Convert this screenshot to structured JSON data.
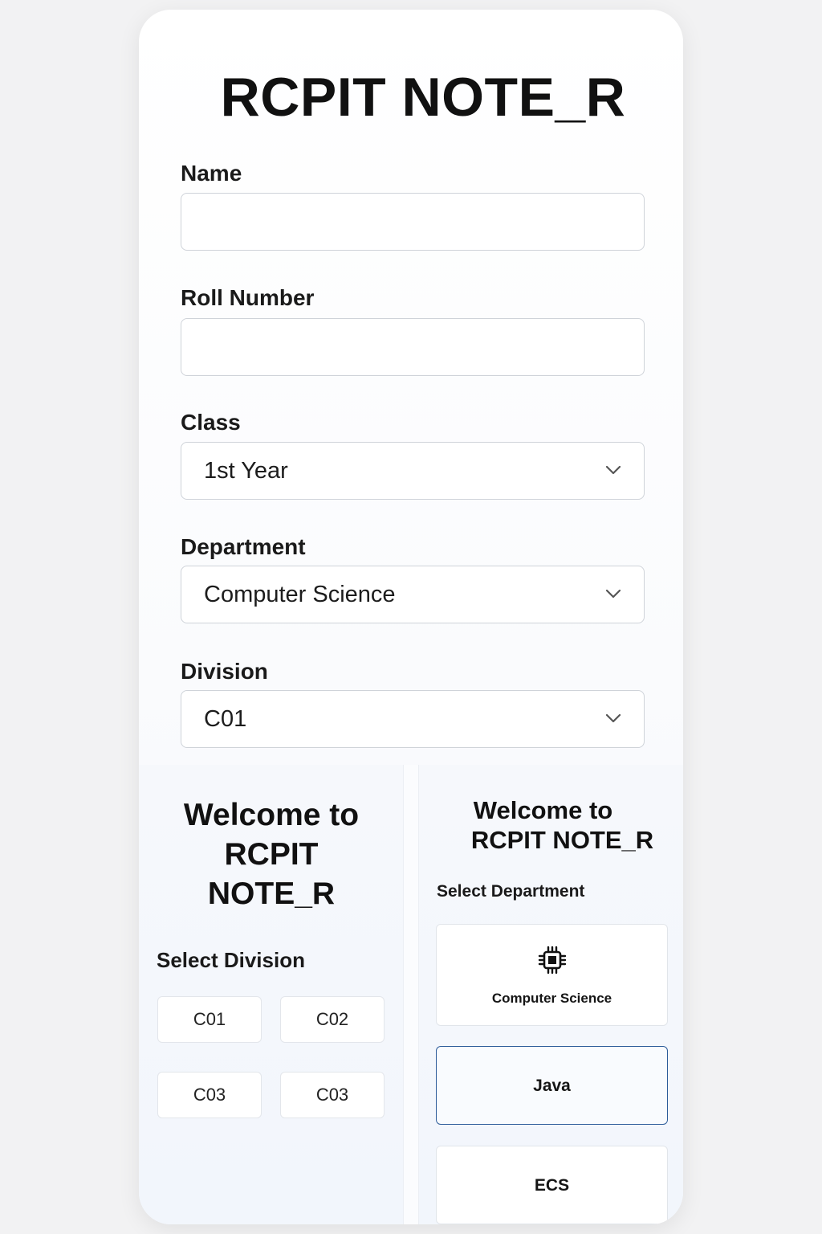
{
  "app": {
    "title": "RCPIT NOTE_R"
  },
  "form": {
    "name_label": "Name",
    "name_value": "",
    "roll_label": "Roll Number",
    "roll_value": "",
    "class_label": "Class",
    "class_value": "1st Year",
    "department_label": "Department",
    "department_value": "Computer Science",
    "division_label": "Division",
    "division_value": "C01"
  },
  "left_panel": {
    "welcome_line1": "Welcome to",
    "welcome_line2": "RCPIT",
    "welcome_line3": "NOTE_R",
    "select_label": "Select Division",
    "divisions": [
      "C01",
      "C02",
      "C03",
      "C03"
    ]
  },
  "right_panel": {
    "welcome_line1": "Welcome to",
    "welcome_line2": "RCPIT NOTE_R",
    "select_label": "Select Department",
    "departments": [
      {
        "label": "Computer Science",
        "icon": "cpu-chip-icon"
      },
      {
        "label": "Java"
      },
      {
        "label": "ECS"
      }
    ],
    "selected_department": "Java"
  },
  "colors": {
    "page_bg": "#f2f2f3",
    "card_bg": "#ffffff",
    "border": "#cfd3d9",
    "accent_border": "#2d5c9a",
    "text": "#111111"
  }
}
